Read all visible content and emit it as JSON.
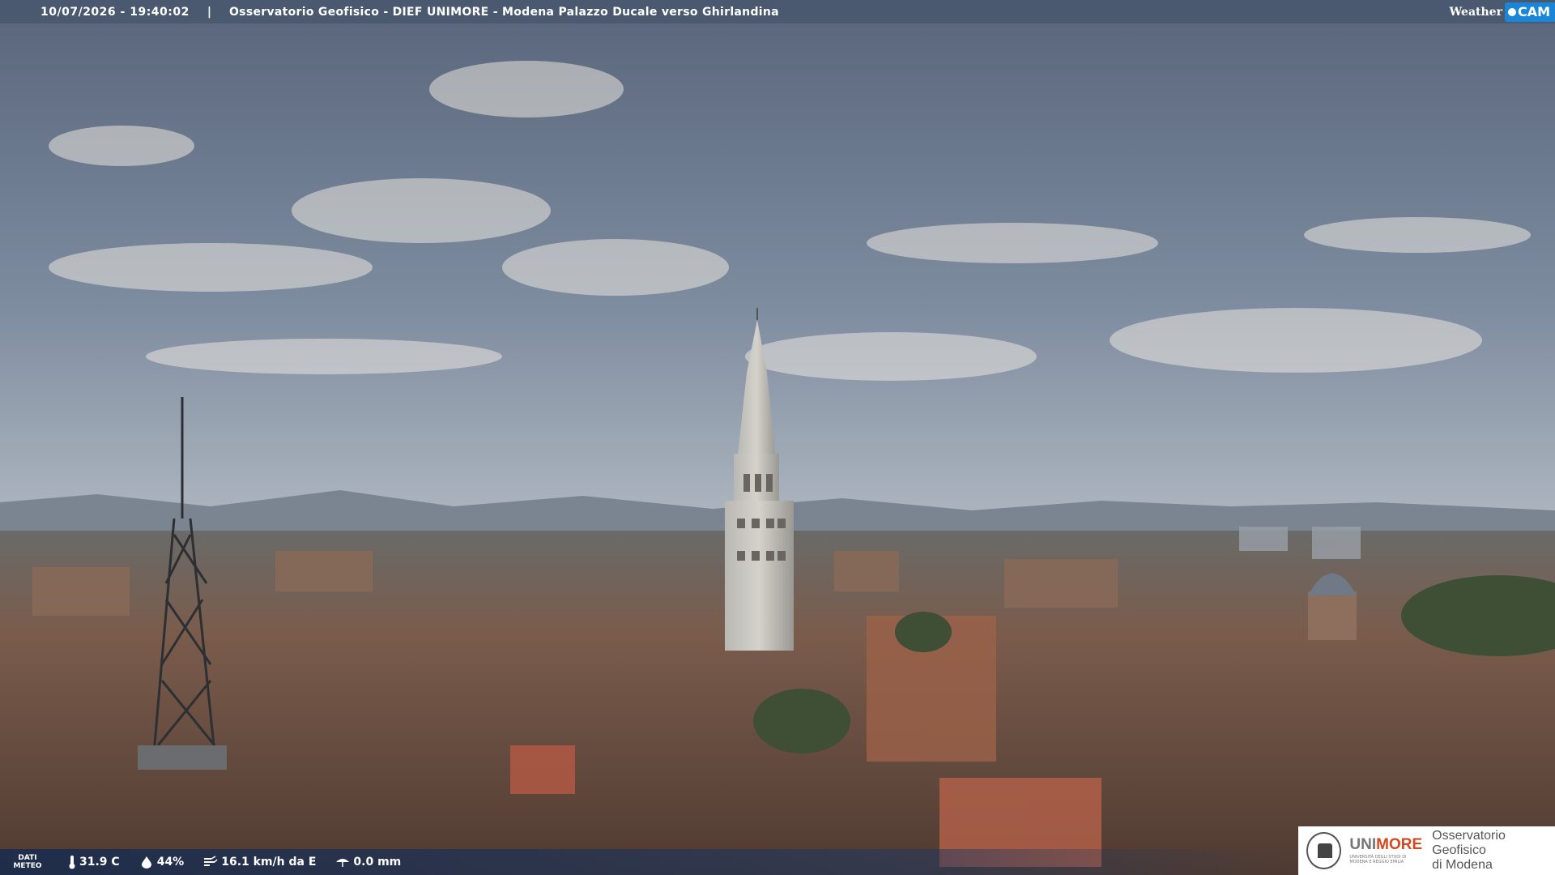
{
  "overlay": {
    "timestamp": "10/07/2026 - 19:40:02",
    "separator": "|",
    "title": "Osservatorio Geofisico - DIEF UNIMORE - Modena Palazzo Ducale verso Ghirlandina",
    "brand_weather": "Weather",
    "brand_cam": "CAM"
  },
  "weather_bar": {
    "label_line1": "DATI",
    "label_line2": "METEO",
    "temperature": "31.9 C",
    "humidity": "44%",
    "wind": "16.1 km/h da E",
    "rain": "0.0 mm"
  },
  "logo": {
    "uni_part1": "UNI",
    "uni_part2": "MORE",
    "uni_small_line1": "UNIVERSITÀ DEGLI STUDI DI",
    "uni_small_line2": "MODENA E REGGIO EMILIA",
    "obs_line1": "Osservatorio Geofisico",
    "obs_line2": "di Modena"
  },
  "colors": {
    "sky_top": "#5f6b7d",
    "sky_horizon": "#e8d9c2",
    "roofs": "#6b4a3c",
    "brand_blue": "#1a86d8",
    "unimore_orange": "#d4491f"
  }
}
